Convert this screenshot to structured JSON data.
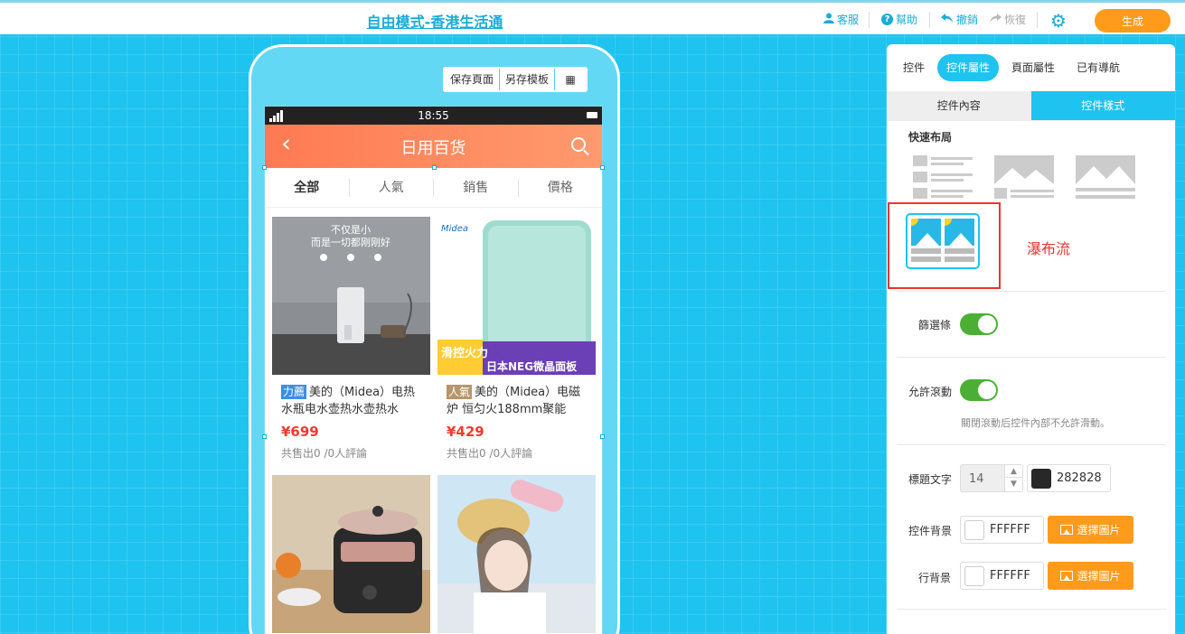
{
  "header": {
    "title": "自由模式-香港生活通",
    "service": "客服",
    "help": "幫助",
    "undo": "撤銷",
    "redo": "恢復",
    "generate": "生成"
  },
  "phone": {
    "tools": [
      "保存頁面",
      "另存模板",
      "▦"
    ],
    "status_time": "18:55",
    "nav_title": "日用百货",
    "filter_tabs": [
      "全部",
      "人氣",
      "銷售",
      "價格"
    ],
    "products": [
      {
        "tag": "力薦",
        "tag_color": "#3a8ee6",
        "name": "美的（Midea）电热水瓶电水壶热水壶热水",
        "price": "¥699",
        "sold": "共售出0 /0人評論",
        "image_text": [
          "不仅是小",
          "而是一切都刚刚好"
        ]
      },
      {
        "tag": "人氣",
        "tag_color": "#b8956a",
        "name": "美的（Midea）电磁炉 恒匀火188mm聚能",
        "price": "¥429",
        "sold": "共售出0 /0人評論",
        "image_text": [
          "Midea",
          "滑控火力",
          "日本NEG微晶面板"
        ]
      },
      {
        "tag": "",
        "name": "",
        "price": "",
        "sold": ""
      },
      {
        "tag": "",
        "name": "",
        "price": "",
        "sold": ""
      }
    ]
  },
  "panel": {
    "tabs": [
      "控件",
      "控件屬性",
      "頁面屬性",
      "已有導航"
    ],
    "active_tab": "控件屬性",
    "subtabs": [
      "控件內容",
      "控件樣式"
    ],
    "quick_layout_label": "快速布局",
    "waterfall_label": "瀑布流",
    "filter_bar_label": "篩選條",
    "filter_bar_on": true,
    "scroll_label": "允許滾動",
    "scroll_on": true,
    "scroll_hint": "關閉滾動后控件內部不允許滑動。",
    "title_text_label": "標題文字",
    "title_font_size": "14",
    "title_color": "282828",
    "bg_label": "控件背景",
    "bg_color": "FFFFFF",
    "row_bg_label": "行背景",
    "row_bg_color": "FFFFFF",
    "pick_image": "選擇圖片"
  }
}
